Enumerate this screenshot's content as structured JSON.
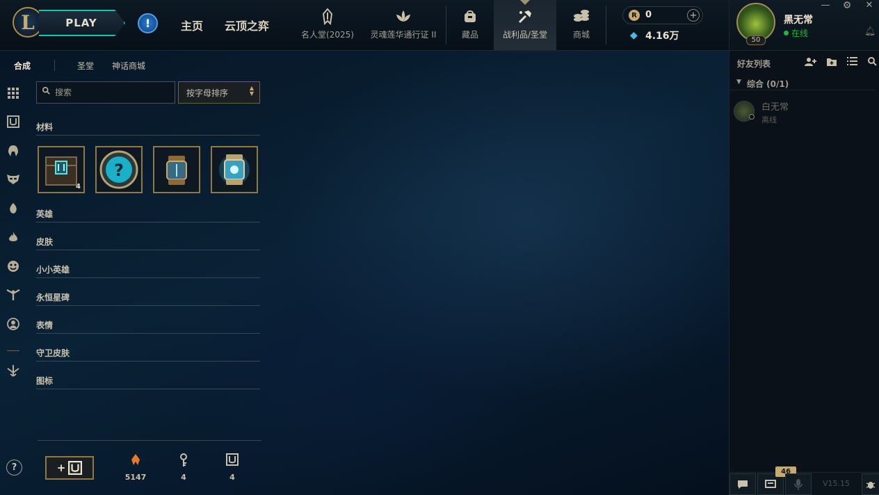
{
  "top_nav": {
    "play_label": "PLAY",
    "home": "主页",
    "tft": "云顶之弈",
    "items": [
      {
        "label": "名人堂(2025)",
        "icon": "hall-of-legends-icon"
      },
      {
        "label": "灵魂莲华通行证 II",
        "icon": "lotus-pass-icon"
      },
      {
        "label": "藏品",
        "icon": "collection-bag-icon"
      },
      {
        "label": "战利品/圣堂",
        "icon": "loot-hammer-icon"
      },
      {
        "label": "商城",
        "icon": "store-coins-icon"
      }
    ],
    "riot_points": "0",
    "blue_essence": "4.16万"
  },
  "profile": {
    "name": "黑无常",
    "status": "在线",
    "level": "50",
    "status_color": "#1eb83c"
  },
  "friends": {
    "title": "好友列表",
    "group_label": "综合 (0/1)",
    "list": [
      {
        "name": "白无常",
        "status": "离线"
      }
    ]
  },
  "social_bar": {
    "notification_count": "46",
    "version": "V15.15"
  },
  "loot": {
    "tabs": [
      "合成",
      "圣堂",
      "神话商城"
    ],
    "search_placeholder": "搜索",
    "sort_label": "按字母排序",
    "sections": {
      "materials": "材料",
      "champions": "英雄",
      "skins": "皮肤",
      "little_legends": "小小英雄",
      "eternals": "永恒星碑",
      "emotes": "表情",
      "ward_skins": "守卫皮肤",
      "icons": "图标"
    },
    "material_items": [
      {
        "name": "hextech-chest",
        "count": "4"
      },
      {
        "name": "mystery-orb",
        "count": ""
      },
      {
        "name": "capsule",
        "count": ""
      },
      {
        "name": "glowing-capsule",
        "count": ""
      }
    ],
    "footer": {
      "orange_essence": "5147",
      "keys": "4",
      "chests": "4"
    }
  },
  "colors": {
    "gold": "#c8aa6e",
    "teal": "#0ac8b9",
    "blue_essence": "#49b7e8",
    "orange_essence": "#e8782a"
  }
}
